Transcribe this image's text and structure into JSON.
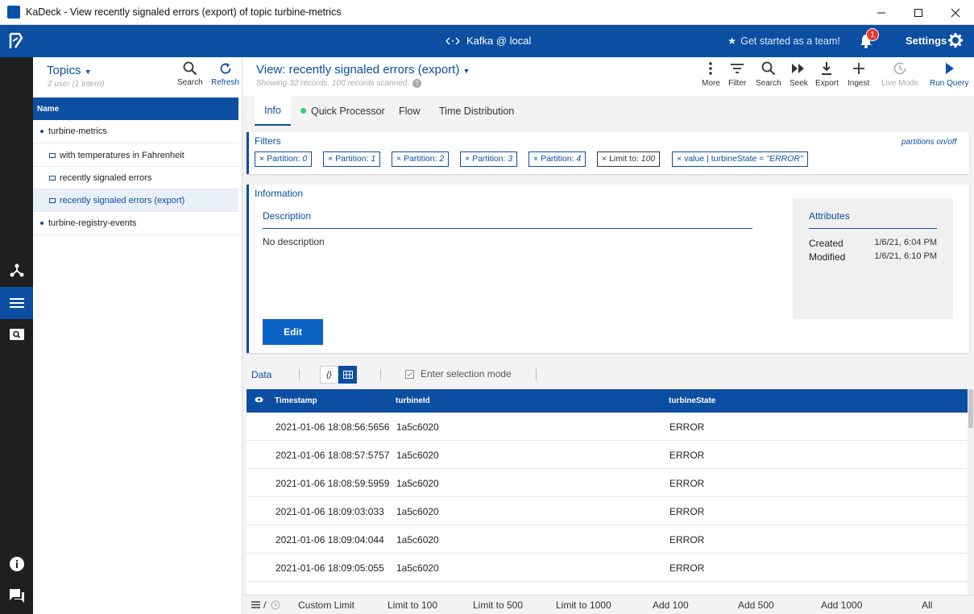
{
  "window": {
    "title": "KaDeck - View recently signaled errors (export) of topic turbine-metrics"
  },
  "topbar": {
    "connection": "Kafka @ local",
    "team": "Get started as a team!",
    "notifications_count": "1",
    "settings": "Settings"
  },
  "topics_panel": {
    "title": "Topics",
    "subtitle": "2 user (1 intern)",
    "search": "Search",
    "refresh": "Refresh",
    "column": "Name",
    "tree": [
      {
        "label": "turbine-metrics"
      },
      {
        "label": "with temperatures in Fahrenheit"
      },
      {
        "label": "recently signaled errors"
      },
      {
        "label": "recently signaled errors (export)"
      },
      {
        "label": "turbine-registry-events"
      }
    ]
  },
  "view": {
    "title": "View: recently signaled errors (export)",
    "subtitle": "Showing 32 records. 100 records scanned.",
    "tools": {
      "more": "More",
      "filter": "Filter",
      "search": "Search",
      "seek": "Seek",
      "export": "Export",
      "ingest": "Ingest",
      "live": "Live Mode",
      "run": "Run Query"
    }
  },
  "tabs": {
    "info": "Info",
    "qp": "Quick Processor",
    "flow": "Flow",
    "td": "Time Distribution"
  },
  "filters": {
    "title": "Filters",
    "toggle": "partitions on/off",
    "chips": [
      {
        "label": "Partition: ",
        "value": "0"
      },
      {
        "label": "Partition: ",
        "value": "1"
      },
      {
        "label": "Partition: ",
        "value": "2"
      },
      {
        "label": "Partition: ",
        "value": "3"
      },
      {
        "label": "Partition: ",
        "value": "4"
      },
      {
        "label": "Limit to: ",
        "value": "100"
      },
      {
        "label": "value | turbineState = ",
        "value": "\"ERROR\""
      }
    ]
  },
  "info": {
    "title": "Information",
    "description_header": "Description",
    "description": "No description",
    "edit": "Edit",
    "attributes_header": "Attributes",
    "created_label": "Created",
    "created_value": "1/6/21, 6:04 PM",
    "modified_label": "Modified",
    "modified_value": "1/6/21, 6:10 PM"
  },
  "data": {
    "label": "Data",
    "json_toggle": "{}",
    "selection_mode": "Enter selection mode",
    "columns": {
      "timestamp": "Timestamp",
      "turbine_id": "turbineId",
      "turbine_state": "turbineState"
    },
    "rows": [
      {
        "ts": "2021-01-06 18:08:56:5656",
        "id": "1a5c6020",
        "state": "ERROR"
      },
      {
        "ts": "2021-01-06 18:08:57:5757",
        "id": "1a5c6020",
        "state": "ERROR"
      },
      {
        "ts": "2021-01-06 18:08:59:5959",
        "id": "1a5c6020",
        "state": "ERROR"
      },
      {
        "ts": "2021-01-06 18:09:03:033",
        "id": "1a5c6020",
        "state": "ERROR"
      },
      {
        "ts": "2021-01-06 18:09:04:044",
        "id": "1a5c6020",
        "state": "ERROR"
      },
      {
        "ts": "2021-01-06 18:09:05:055",
        "id": "1a5c6020",
        "state": "ERROR"
      }
    ]
  },
  "footer": {
    "slash": "/",
    "custom": "Custom Limit",
    "l100": "Limit to 100",
    "l500": "Limit to 500",
    "l1000": "Limit to 1000",
    "a100": "Add 100",
    "a500": "Add 500",
    "a1000": "Add 1000",
    "all": "All"
  },
  "colors": {
    "primary": "#0b4ea2",
    "button": "#0b63c6",
    "badge": "#e53935",
    "online": "#2ecc71"
  }
}
